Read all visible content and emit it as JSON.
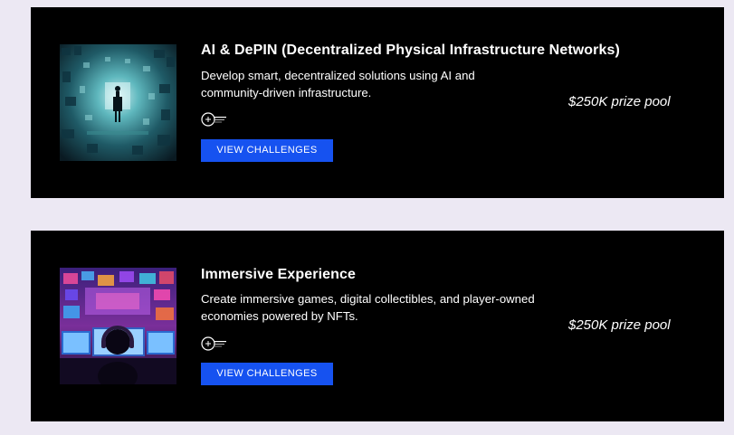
{
  "tracks": [
    {
      "title": "AI & DePIN (Decentralized Physical Infrastructure Networks)",
      "description": "Develop smart, decentralized solutions using AI and community-driven infrastructure.",
      "cta_label": "VIEW CHALLENGES",
      "prize": "$250K prize pool",
      "image_icon": "ai-depin-artwork",
      "sponsor_icon": "sponsor-logo"
    },
    {
      "title": "Immersive Experience",
      "description": "Create immersive games, digital collectibles, and player-owned economies powered by NFTs.",
      "cta_label": "VIEW CHALLENGES",
      "prize": "$250K prize pool",
      "image_icon": "immersive-experience-artwork",
      "sponsor_icon": "sponsor-logo"
    }
  ],
  "colors": {
    "page_background": "#ece8f3",
    "card_background": "#000000",
    "cta_background": "#1652f0",
    "text": "#ffffff"
  }
}
